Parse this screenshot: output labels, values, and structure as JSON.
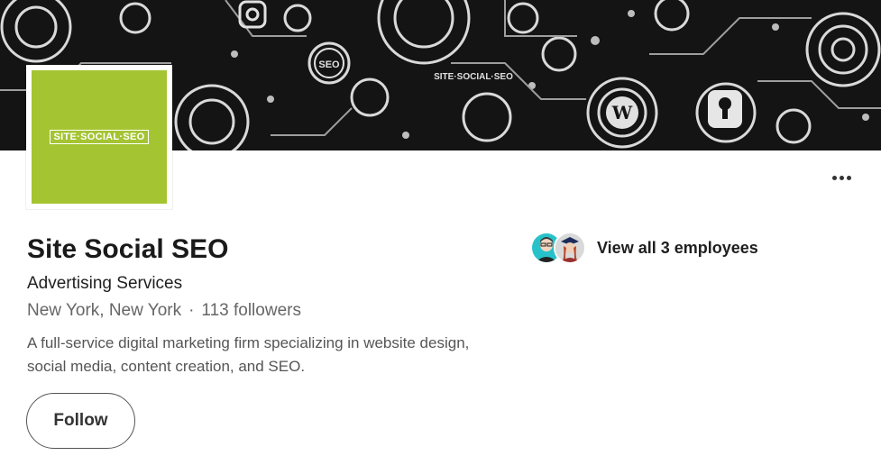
{
  "banner": {
    "logo_text": "SITE·SOCIAL·SEO",
    "badge_text": "SEO"
  },
  "company": {
    "logo_text": "SITE·SOCIAL·SEO",
    "name": "Site Social SEO",
    "industry": "Advertising Services",
    "location": "New York, New York",
    "separator": "·",
    "followers": "113 followers",
    "tagline": "A full-service digital marketing firm specializing in website design, social media, content creation, and SEO."
  },
  "actions": {
    "follow_label": "Follow",
    "more_icon": "more-horizontal-icon"
  },
  "employees": {
    "label": "View all 3 employees"
  },
  "colors": {
    "brand_green": "#a4c432",
    "banner_bg": "#141414"
  }
}
